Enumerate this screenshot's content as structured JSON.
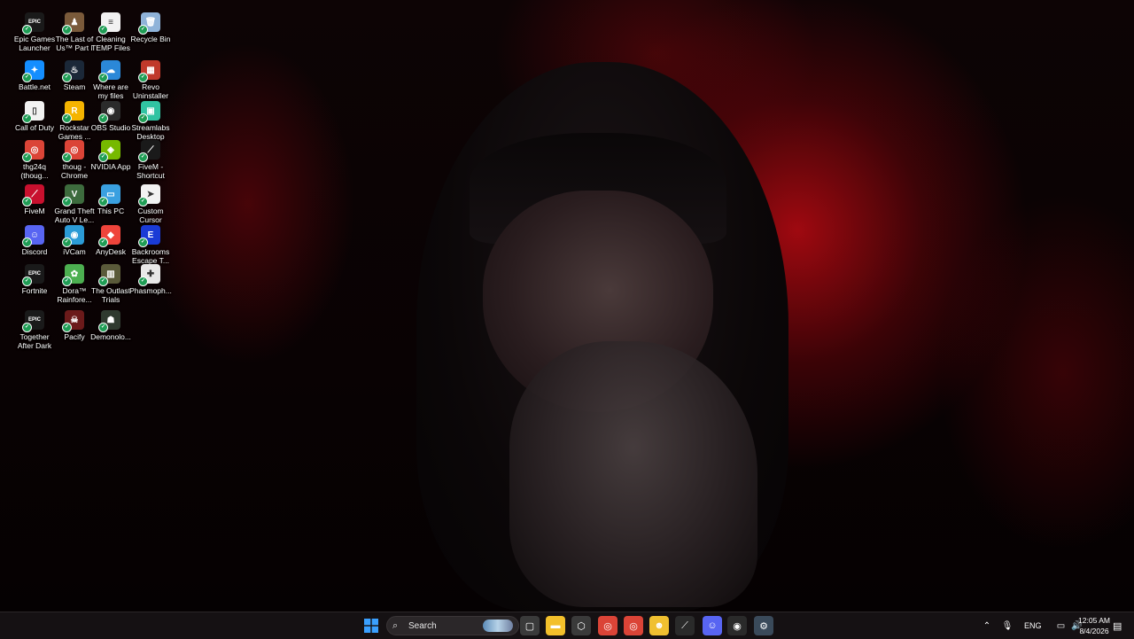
{
  "desktop": {
    "icons": [
      {
        "label": "Epic Games Launcher",
        "icon": "epic-games-icon",
        "color": "#1a1a1a",
        "glyph": "EPIC"
      },
      {
        "label": "The Last of Us™ Part I",
        "icon": "the-last-of-us-icon",
        "color": "#7a5a3a",
        "glyph": "♟"
      },
      {
        "label": "Cleaning TEMP Files",
        "icon": "document-icon",
        "color": "#f2f2f2",
        "glyph": "≡"
      },
      {
        "label": "Recycle Bin",
        "icon": "recycle-bin-icon",
        "color": "#8fb3d9",
        "glyph": "🗑"
      },
      {
        "label": "Battle.net",
        "icon": "battle-net-icon",
        "color": "#148eff",
        "glyph": "✦"
      },
      {
        "label": "Steam",
        "icon": "steam-icon",
        "color": "#1b2838",
        "glyph": "♨"
      },
      {
        "label": "Where are my files",
        "icon": "onedrive-icon",
        "color": "#2b88d8",
        "glyph": "☁"
      },
      {
        "label": "Revo Uninstaller",
        "icon": "revo-uninstaller-icon",
        "color": "#c0392b",
        "glyph": "▦"
      },
      {
        "label": "Call of Duty",
        "icon": "call-of-duty-icon",
        "color": "#f2f2f2",
        "glyph": "▯"
      },
      {
        "label": "Rockstar Games ...",
        "icon": "rockstar-games-icon",
        "color": "#f5b400",
        "glyph": "R"
      },
      {
        "label": "OBS Studio",
        "icon": "obs-studio-icon",
        "color": "#2b2b2b",
        "glyph": "◉"
      },
      {
        "label": "Streamlabs Desktop",
        "icon": "streamlabs-icon",
        "color": "#31c3a2",
        "glyph": "▣"
      },
      {
        "label": "thg24q (thoug...",
        "icon": "chrome-icon",
        "color": "#db4437",
        "glyph": "◎"
      },
      {
        "label": "thoug - Chrome",
        "icon": "chrome-icon",
        "color": "#db4437",
        "glyph": "◎"
      },
      {
        "label": "NVIDIA App",
        "icon": "nvidia-icon",
        "color": "#76b900",
        "glyph": "◈"
      },
      {
        "label": "FiveM - Shortcut",
        "icon": "fivem-icon",
        "color": "#1a1a1a",
        "glyph": "⟋"
      },
      {
        "label": "FiveM",
        "icon": "fivem-icon",
        "color": "#c8102e",
        "glyph": "⟋"
      },
      {
        "label": "Grand Theft Auto V Le...",
        "icon": "gta-v-icon",
        "color": "#3d6b3d",
        "glyph": "V"
      },
      {
        "label": "This PC",
        "icon": "this-pc-icon",
        "color": "#3aa0e0",
        "glyph": "▭"
      },
      {
        "label": "Custom Cursor",
        "icon": "custom-cursor-icon",
        "color": "#f2f2f2",
        "glyph": "➤"
      },
      {
        "label": "Discord",
        "icon": "discord-icon",
        "color": "#5865f2",
        "glyph": "☺"
      },
      {
        "label": "iVCam",
        "icon": "ivcam-icon",
        "color": "#2b9bd6",
        "glyph": "◉"
      },
      {
        "label": "AnyDesk",
        "icon": "anydesk-icon",
        "color": "#ef443b",
        "glyph": "◆"
      },
      {
        "label": "Backrooms Escape T...",
        "icon": "backrooms-icon",
        "color": "#1a3bd6",
        "glyph": "E"
      },
      {
        "label": "Fortnite",
        "icon": "fortnite-icon",
        "color": "#1a1a1a",
        "glyph": "EPIC"
      },
      {
        "label": "Dora™ Rainfore...",
        "icon": "dora-icon",
        "color": "#4caf50",
        "glyph": "✿"
      },
      {
        "label": "The Outlast Trials",
        "icon": "outlast-icon",
        "color": "#5a5a3a",
        "glyph": "▥"
      },
      {
        "label": "Phasmoph...",
        "icon": "phasmophobia-icon",
        "color": "#e8e8e8",
        "glyph": "✚"
      },
      {
        "label": "Together After Dark",
        "icon": "epic-games-icon",
        "color": "#1a1a1a",
        "glyph": "EPIC"
      },
      {
        "label": "Pacify",
        "icon": "pacify-icon",
        "color": "#6b1a1a",
        "glyph": "☠"
      },
      {
        "label": "Demonolo...",
        "icon": "demonologist-icon",
        "color": "#2f3a2f",
        "glyph": "☗"
      }
    ]
  },
  "taskbar": {
    "start_icon": "windows-start-icon",
    "search_placeholder": "Search",
    "pinned": [
      {
        "name": "task-view-icon",
        "glyph": "▢",
        "color": "#3a3a3a"
      },
      {
        "name": "file-explorer-icon",
        "glyph": "▬",
        "color": "#f3c02b"
      },
      {
        "name": "settings-app-icon",
        "glyph": "⬡",
        "color": "#3a3a3a"
      },
      {
        "name": "chrome-profile-icon",
        "glyph": "◎",
        "color": "#db4437"
      },
      {
        "name": "chrome-icon",
        "glyph": "◎",
        "color": "#db4437"
      },
      {
        "name": "emoji-app-icon",
        "glyph": "☻",
        "color": "#f0c030"
      },
      {
        "name": "fivem-taskbar-icon",
        "glyph": "⟋",
        "color": "#2a2a2a"
      },
      {
        "name": "discord-taskbar-icon",
        "glyph": "☺",
        "color": "#5865f2"
      },
      {
        "name": "obs-taskbar-icon",
        "glyph": "◉",
        "color": "#2a2a2a"
      },
      {
        "name": "settings-gear-icon",
        "glyph": "⚙",
        "color": "#3a4a5a"
      }
    ],
    "tray": {
      "language": "ENG",
      "time": "12:05 AM",
      "date": "8/4/2026"
    }
  }
}
